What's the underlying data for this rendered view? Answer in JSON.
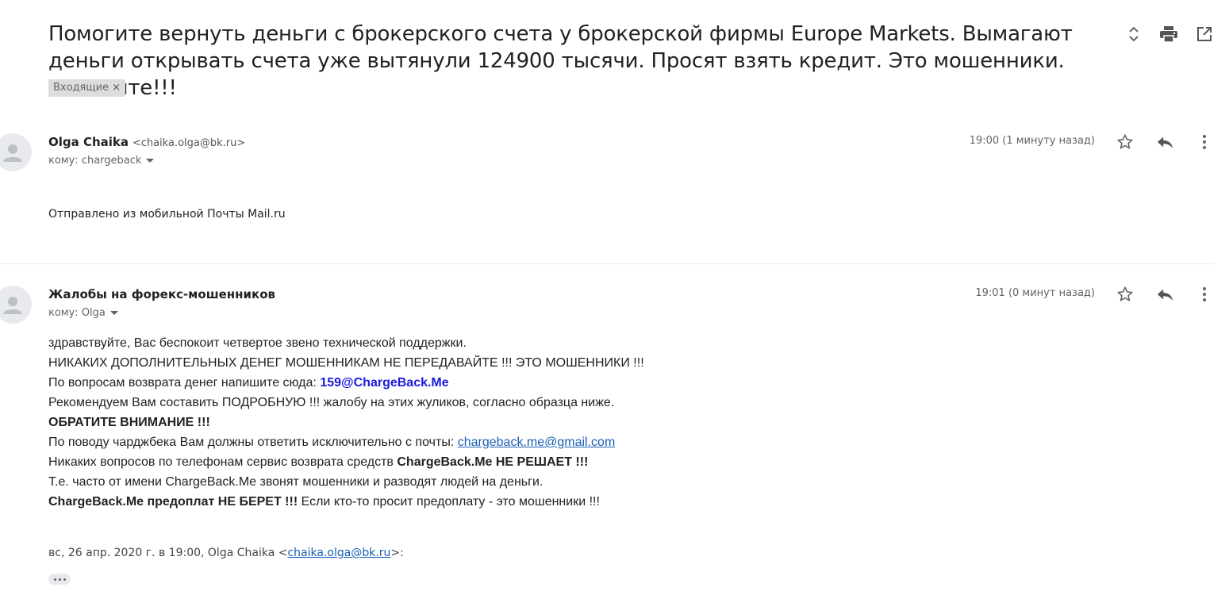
{
  "thread": {
    "subject": "Помогите вернуть деньги с брокерского счета у брокерской фирмы Europe Markets. Вымагают деньги открывать счета уже вытянули 124900 тысячи. Просят взять кредит. Это мошенники. Помогите!!!",
    "label": "Входящие",
    "label_close": "×"
  },
  "messages": [
    {
      "sender_name": "Olga Chaika",
      "sender_email": "<chaika.olga@bk.ru>",
      "to": "кому: chargeback",
      "time": "19:00 (1 минуту назад)",
      "body": "Отправлено из мобильной Почты Mail.ru"
    },
    {
      "sender_name": "Жалобы на форекс-мошенников",
      "to": "кому: Olga",
      "time": "19:01 (0 минут назад)",
      "body": {
        "l1": "здравствуйте, Вас беспокоит четвертое звено технической поддержки.",
        "l2": "НИКАКИХ ДОПОЛНИТЕЛЬНЫХ ДЕНЕГ МОШЕННИКАМ НЕ ПЕРЕДАВАЙТЕ !!! ЭТО МОШЕННИКИ !!!",
        "l3_prefix": "По вопросам возврата денег напишите сюда: ",
        "l3_email": "159@ChargeBack.Me",
        "l4": "Рекомендуем Вам составить ПОДРОБНУЮ !!! жалобу на этих жуликов, согласно образца ниже.",
        "l5": "ОБРАТИТЕ ВНИМАНИЕ !!!",
        "l6_prefix": "По поводу чарджбека Вам должны ответить исключительно с почты: ",
        "l6_link": "chargeback.me@gmail.com",
        "l7_prefix": "Никаких вопросов по телефонам сервис возврата средств ",
        "l7_bold": "ChargeBack.Me НЕ РЕШАЕТ !!!",
        "l8": "Т.е. часто от имени ChargeBack.Me звонят мошенники и разводят людей на деньги.",
        "l9_bold": "ChargeBack.Me предоплат НЕ БЕРЕТ !!!",
        "l9_suffix": " Если кто-то просит предоплату - это мошенники !!!"
      },
      "quote_prefix": "вс, 26 апр. 2020 г. в 19:00, Olga Chaika <",
      "quote_link": "chaika.olga@bk.ru",
      "quote_suffix": ">:"
    }
  ],
  "icons": [
    "expand-collapse-icon",
    "print-icon",
    "open-in-new-window-icon",
    "avatar-person-icon",
    "star-icon",
    "reply-icon",
    "more-vert-icon"
  ]
}
